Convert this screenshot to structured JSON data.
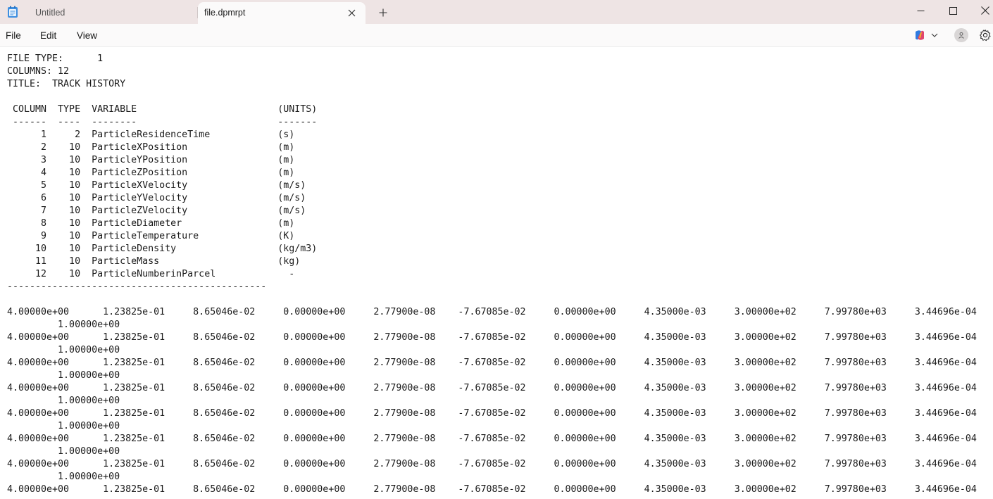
{
  "tabs": {
    "inactive_title": "Untitled",
    "active_title": "file.dpmrpt",
    "new_tab_symbol": "+"
  },
  "menu": {
    "file": "File",
    "edit": "Edit",
    "view": "View"
  },
  "icons": {
    "app": "notepad-icon",
    "close_tab": "close-icon",
    "new_tab": "plus-icon",
    "minimize": "minimize-icon",
    "maximize": "maximize-icon",
    "close_window": "close-icon",
    "copilot": "copilot-icon",
    "account": "account-icon",
    "settings": "gear-icon"
  },
  "colors": {
    "titlebar_bg": "#eee4e4",
    "active_tab_bg": "#fbfafa",
    "editor_bg": "#ffffff",
    "text": "#1a1a1a"
  },
  "document": {
    "lines": [
      "FILE TYPE:      1",
      "COLUMNS: 12",
      "TITLE:  TRACK HISTORY",
      "",
      " COLUMN  TYPE  VARIABLE                         (UNITS)",
      " ------  ----  --------                         -------",
      "      1     2  ParticleResidenceTime            (s)",
      "      2    10  ParticleXPosition                (m)",
      "      3    10  ParticleYPosition                (m)",
      "      4    10  ParticleZPosition                (m)",
      "      5    10  ParticleXVelocity                (m/s)",
      "      6    10  ParticleYVelocity                (m/s)",
      "      7    10  ParticleZVelocity                (m/s)",
      "      8    10  ParticleDiameter                 (m)",
      "      9    10  ParticleTemperature              (K)",
      "     10    10  ParticleDensity                  (kg/m3)",
      "     11    10  ParticleMass                     (kg)",
      "     12    10  ParticleNumberinParcel             -",
      "----------------------------------------------",
      "",
      "4.00000e+00      1.23825e-01     8.65046e-02     0.00000e+00     2.77900e-08    -7.67085e-02     0.00000e+00     4.35000e-03     3.00000e+02     7.99780e+03     3.44696e-04",
      "         1.00000e+00",
      "4.00000e+00      1.23825e-01     8.65046e-02     0.00000e+00     2.77900e-08    -7.67085e-02     0.00000e+00     4.35000e-03     3.00000e+02     7.99780e+03     3.44696e-04",
      "         1.00000e+00",
      "4.00000e+00      1.23825e-01     8.65046e-02     0.00000e+00     2.77900e-08    -7.67085e-02     0.00000e+00     4.35000e-03     3.00000e+02     7.99780e+03     3.44696e-04",
      "         1.00000e+00",
      "4.00000e+00      1.23825e-01     8.65046e-02     0.00000e+00     2.77900e-08    -7.67085e-02     0.00000e+00     4.35000e-03     3.00000e+02     7.99780e+03     3.44696e-04",
      "         1.00000e+00",
      "4.00000e+00      1.23825e-01     8.65046e-02     0.00000e+00     2.77900e-08    -7.67085e-02     0.00000e+00     4.35000e-03     3.00000e+02     7.99780e+03     3.44696e-04",
      "         1.00000e+00",
      "4.00000e+00      1.23825e-01     8.65046e-02     0.00000e+00     2.77900e-08    -7.67085e-02     0.00000e+00     4.35000e-03     3.00000e+02     7.99780e+03     3.44696e-04",
      "         1.00000e+00",
      "4.00000e+00      1.23825e-01     8.65046e-02     0.00000e+00     2.77900e-08    -7.67085e-02     0.00000e+00     4.35000e-03     3.00000e+02     7.99780e+03     3.44696e-04",
      "         1.00000e+00",
      "4.00000e+00      1.23825e-01     8.65046e-02     0.00000e+00     2.77900e-08    -7.67085e-02     0.00000e+00     4.35000e-03     3.00000e+02     7.99780e+03     3.44696e-04"
    ]
  }
}
